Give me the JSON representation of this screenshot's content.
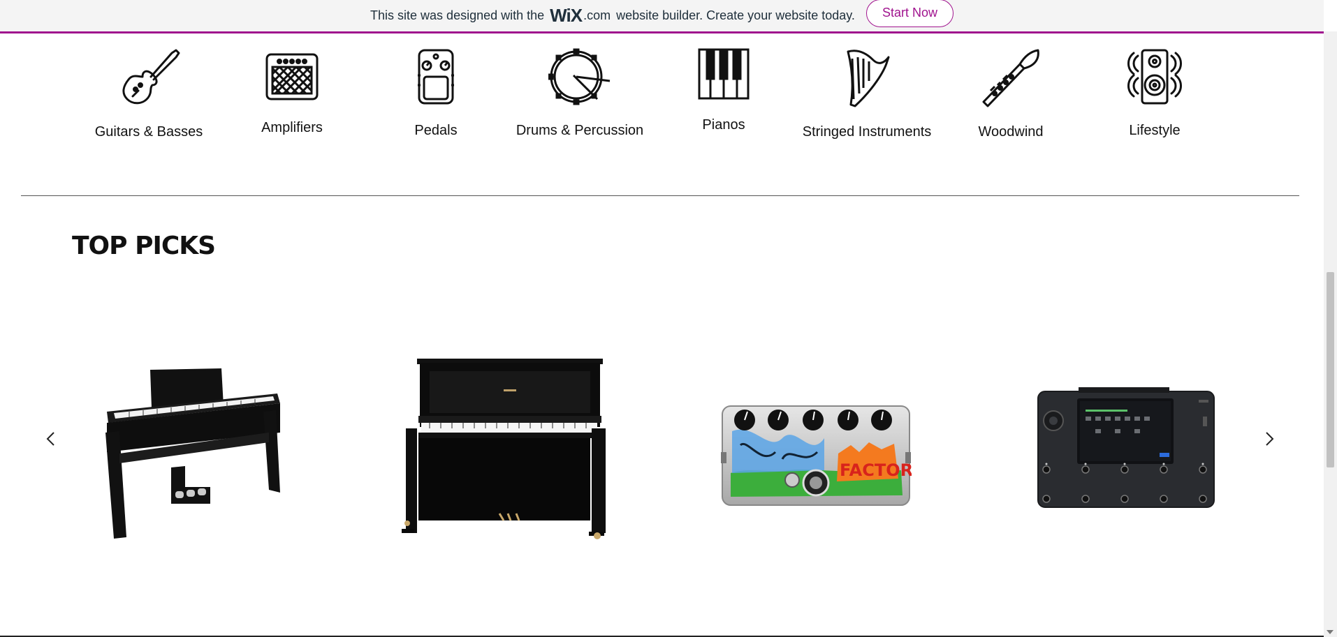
{
  "banner": {
    "prefix": "This site was designed with the",
    "brand": "WiX",
    "brand_suffix": ".com",
    "suffix": "website builder. Create your website today.",
    "button": "Start Now",
    "accent": "#a0138e"
  },
  "categories": [
    {
      "label": "Guitars & Basses",
      "icon": "electric-guitar-icon"
    },
    {
      "label": "Amplifiers",
      "icon": "amplifier-icon"
    },
    {
      "label": "Pedals",
      "icon": "effects-pedal-icon"
    },
    {
      "label": "Drums & Percussion",
      "icon": "drum-icon"
    },
    {
      "label": "Pianos",
      "icon": "piano-keys-icon"
    },
    {
      "label": "Stringed Instruments",
      "icon": "harp-icon"
    },
    {
      "label": "Woodwind",
      "icon": "clarinet-icon"
    },
    {
      "label": "Lifestyle",
      "icon": "speaker-icon"
    }
  ],
  "top_picks": {
    "title": "TOP PICKS",
    "products": [
      {
        "image": "digital-piano-image"
      },
      {
        "image": "upright-piano-image"
      },
      {
        "image": "fuzz-pedal-image"
      },
      {
        "image": "multi-effects-processor-image"
      }
    ],
    "pedal_art_text": "FACTORY"
  }
}
